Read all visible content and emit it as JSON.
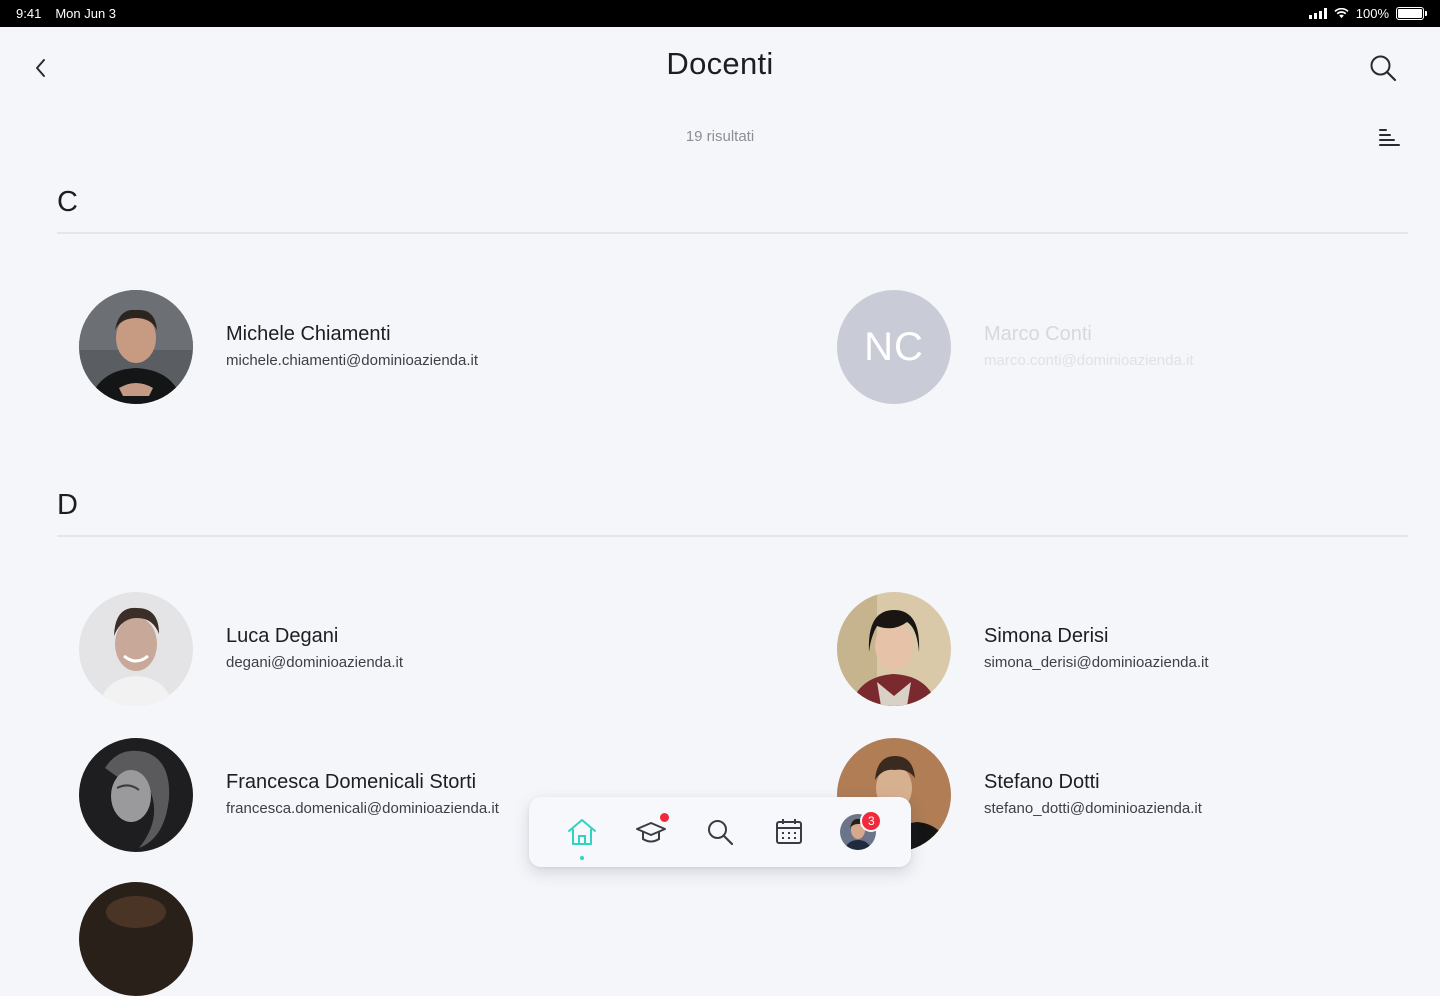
{
  "status_bar": {
    "time": "9:41",
    "date": "Mon Jun 3",
    "battery": "100%"
  },
  "header": {
    "title": "Docenti",
    "back_icon": "chevron-left-icon",
    "search_icon": "search-icon"
  },
  "results_label": "19 risultati",
  "sort_icon": "sort-icon",
  "sections": [
    {
      "letter": "C",
      "contacts": [
        {
          "name": "Michele Chiamenti",
          "email": "michele.chiamenti@dominioazienda.it",
          "avatar": "photo",
          "disabled": false
        },
        {
          "name": "Marco Conti",
          "email": "marco.conti@dominioazienda.it",
          "avatar": "initials",
          "initials": "NC",
          "disabled": true
        }
      ]
    },
    {
      "letter": "D",
      "contacts": [
        {
          "name": "Luca Degani",
          "email": "degani@dominioazienda.it",
          "avatar": "photo",
          "disabled": false
        },
        {
          "name": "Simona Derisi",
          "email": "simona_derisi@dominioazienda.it",
          "avatar": "photo",
          "disabled": false
        },
        {
          "name": "Francesca Domenicali Storti",
          "email": "francesca.domenicali@dominioazienda.it",
          "avatar": "photo",
          "disabled": false
        },
        {
          "name": "Stefano Dotti",
          "email": "stefano_dotti@dominioazienda.it",
          "avatar": "photo",
          "disabled": false
        }
      ]
    }
  ],
  "bottom_nav": {
    "items": [
      "home-icon",
      "courses-icon",
      "search-icon",
      "calendar-icon",
      "profile-avatar"
    ],
    "active": "home-icon",
    "profile_badge": "3"
  },
  "colors": {
    "accent": "#2fd3c0",
    "badge": "#f0293d",
    "background": "#f5f6fa"
  }
}
